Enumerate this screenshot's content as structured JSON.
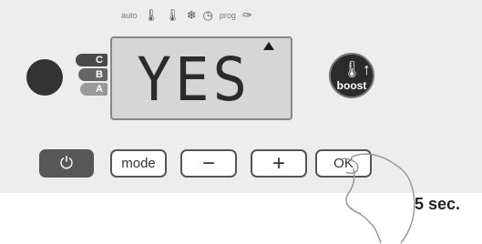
{
  "mode_strip": {
    "auto": "auto",
    "prog": "prog",
    "icons": [
      "thermometer-high-icon",
      "thermometer-low-icon",
      "snowflake-icon",
      "clock-icon",
      "wrench-icon"
    ]
  },
  "program_tags": [
    "C",
    "B",
    "A"
  ],
  "display": {
    "text": "YES"
  },
  "boost": {
    "label": "boost"
  },
  "buttons": {
    "mode": "mode",
    "minus": "−",
    "plus": "+",
    "ok": "OK"
  },
  "hint": "5 sec."
}
